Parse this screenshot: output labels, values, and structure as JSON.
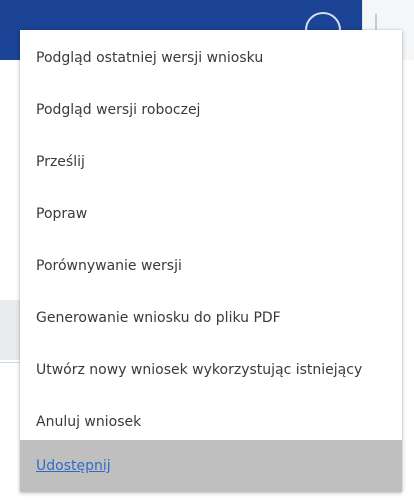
{
  "menu": {
    "items": [
      {
        "label": "Podgląd ostatniej wersji wniosku"
      },
      {
        "label": "Podgląd wersji roboczej"
      },
      {
        "label": "Prześlij"
      },
      {
        "label": "Popraw"
      },
      {
        "label": "Porównywanie wersji"
      },
      {
        "label": "Generowanie wniosku do pliku PDF"
      },
      {
        "label": "Utwórz nowy wniosek wykorzystując istniejący"
      },
      {
        "label": "Anuluj wniosek"
      },
      {
        "label": "Udostępnij",
        "selected": true
      }
    ]
  },
  "colors": {
    "header": "#1b4396",
    "selected_background": "#bfbfbf",
    "selected_link": "#2f6bc4",
    "text": "#3a3a3a"
  }
}
